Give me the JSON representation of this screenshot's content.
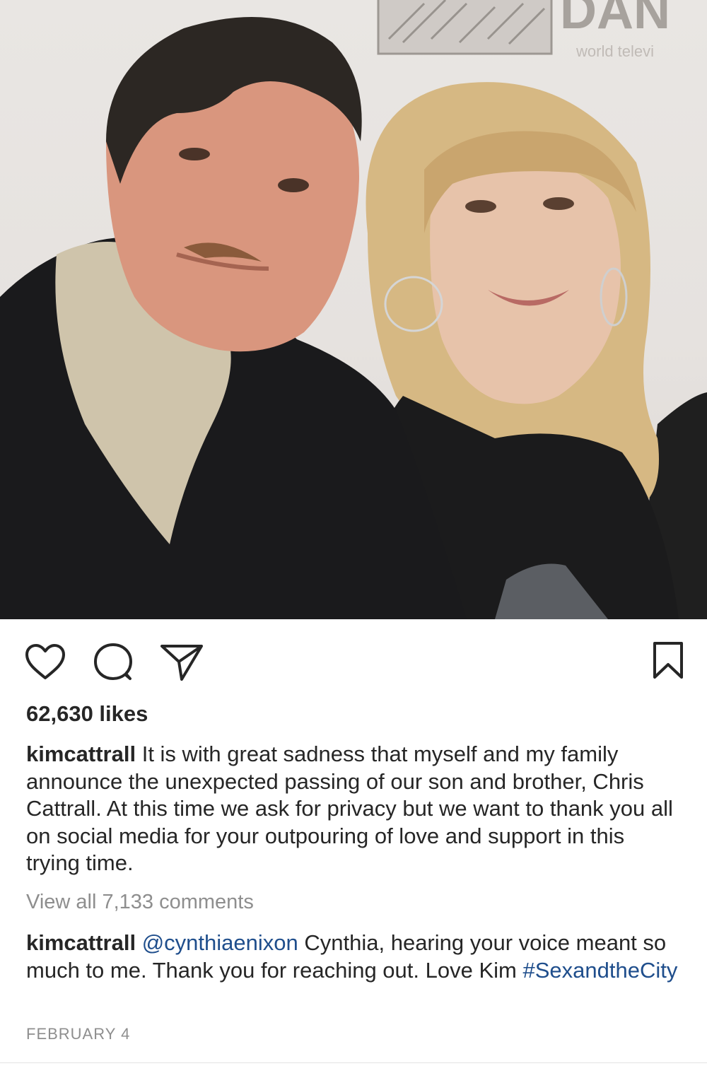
{
  "post": {
    "photo_alt": "Photo of two people",
    "backdrop_text": "DAN",
    "backdrop_subtext": "world televi"
  },
  "actions": {
    "like_icon": "heart-icon",
    "comment_icon": "comment-icon",
    "share_icon": "paper-plane-icon",
    "save_icon": "bookmark-icon"
  },
  "likes": "62,630 likes",
  "caption": {
    "username": "kimcattrall",
    "text": "It is with great sadness that myself and my family announce the unexpected passing of our son and brother, Chris Cattrall. At this time we ask for privacy but we want to thank you all on social media for your outpouring of love and support in this trying time."
  },
  "view_all_comments": "View all 7,133 comments",
  "comment": {
    "username": "kimcattrall",
    "mention": "@cynthiaenixon",
    "text": "Cynthia, hearing your voice meant so much to me. Thank you for reaching out. Love Kim",
    "hashtag": "#SexandtheCity"
  },
  "date": "FEBRUARY 4",
  "colors": {
    "text": "#262626",
    "muted": "#8e8e8e",
    "link": "#1f4e8c"
  }
}
